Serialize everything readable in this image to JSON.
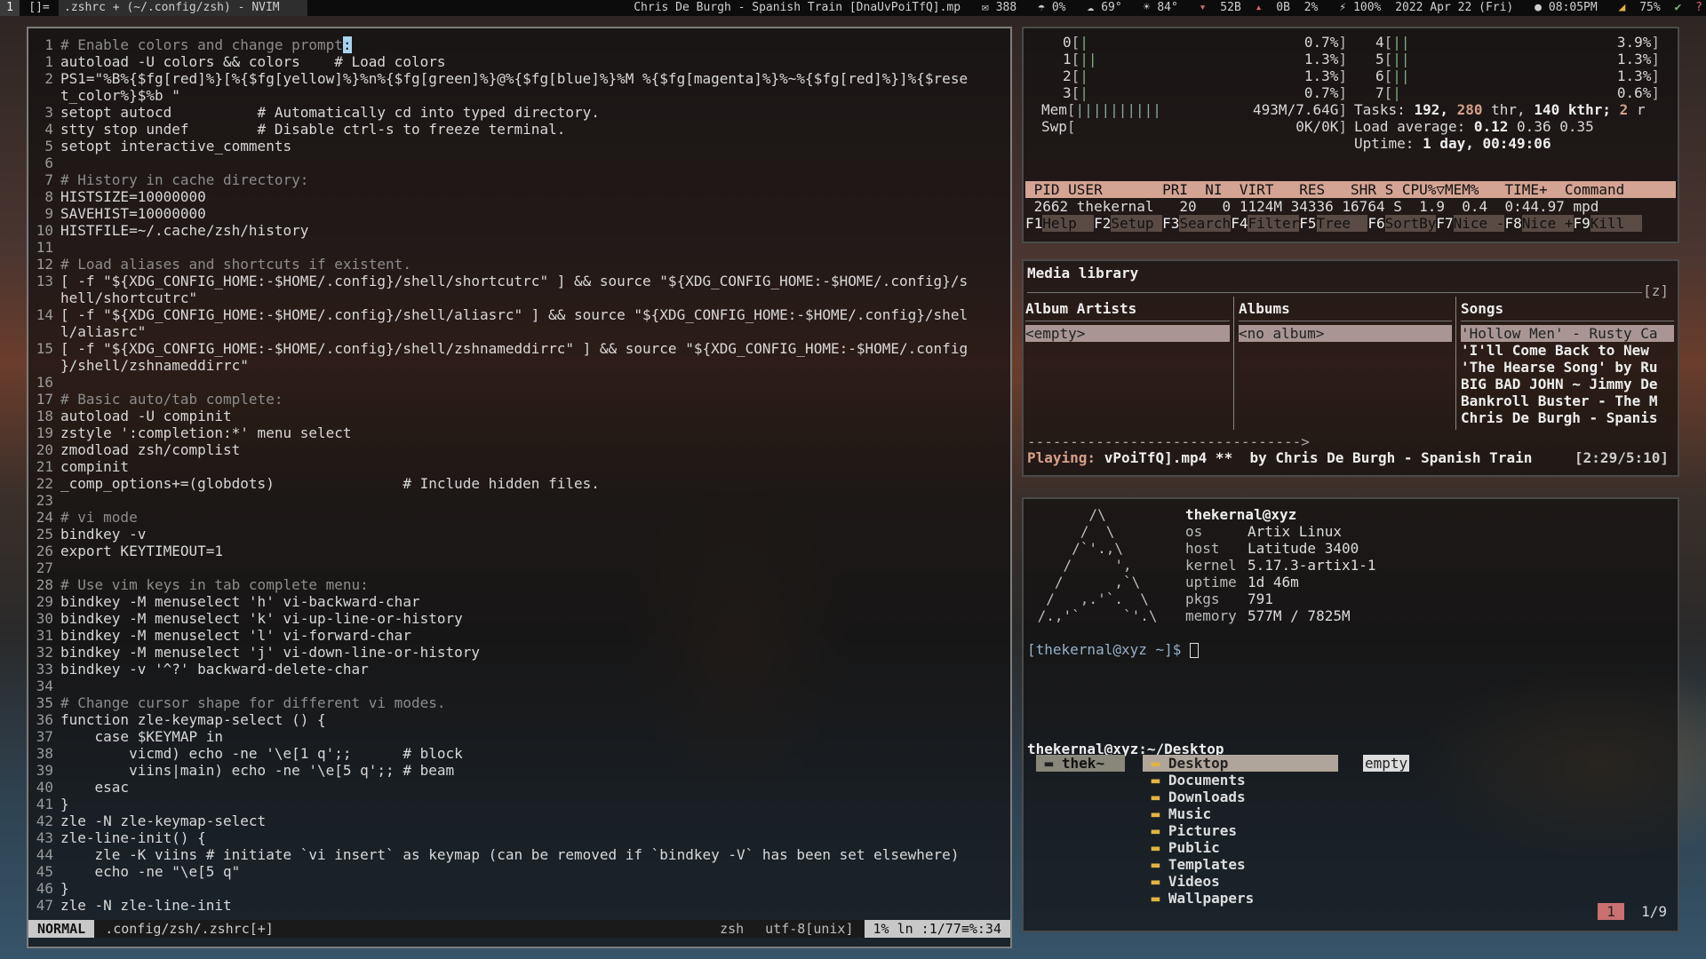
{
  "topbar": {
    "workspace": "1",
    "layout": "[]=",
    "window_title": ".zshrc + (~/.config/zsh) - NVIM",
    "music": "Chris De Burgh - Spanish Train [DnaUvPoiTfQ].mp",
    "mail": "388",
    "rain": "0%",
    "humidity": "69°",
    "temp": "84°",
    "net_down": "52B",
    "net_up": "0B",
    "cpu": "2%",
    "battery": "100%",
    "date": "2022 Apr 22 (Fri)",
    "time": "08:05PM",
    "volume": "75%"
  },
  "editor": {
    "lines": [
      {
        "n": "1",
        "t": "# Enable colors and change prompt",
        "cls": "cm",
        "cursor": ":"
      },
      {
        "n": "1",
        "t": "autoload -U colors && colors    # Load colors"
      },
      {
        "n": "2",
        "t": "PS1=\"%B%{$fg[red]%}[%{$fg[yellow]%}%n%{$fg[green]%}@%{$fg[blue]%}%M %{$fg[magenta]%}%~%{$fg[red]%}]%{$rese"
      },
      {
        "n": "",
        "t": "t_color%}$%b \"",
        "cont": true
      },
      {
        "n": "3",
        "t": "setopt autocd          # Automatically cd into typed directory."
      },
      {
        "n": "4",
        "t": "stty stop undef        # Disable ctrl-s to freeze terminal."
      },
      {
        "n": "5",
        "t": "setopt interactive_comments"
      },
      {
        "n": "6",
        "t": ""
      },
      {
        "n": "7",
        "t": "# History in cache directory:",
        "cls": "cm"
      },
      {
        "n": "8",
        "t": "HISTSIZE=10000000"
      },
      {
        "n": "9",
        "t": "SAVEHIST=10000000"
      },
      {
        "n": "10",
        "t": "HISTFILE=~/.cache/zsh/history"
      },
      {
        "n": "11",
        "t": ""
      },
      {
        "n": "12",
        "t": "# Load aliases and shortcuts if existent.",
        "cls": "cm"
      },
      {
        "n": "13",
        "t": "[ -f \"${XDG_CONFIG_HOME:-$HOME/.config}/shell/shortcutrc\" ] && source \"${XDG_CONFIG_HOME:-$HOME/.config}/s"
      },
      {
        "n": "",
        "t": "hell/shortcutrc\"",
        "cont": true
      },
      {
        "n": "14",
        "t": "[ -f \"${XDG_CONFIG_HOME:-$HOME/.config}/shell/aliasrc\" ] && source \"${XDG_CONFIG_HOME:-$HOME/.config}/shel"
      },
      {
        "n": "",
        "t": "l/aliasrc\"",
        "cont": true
      },
      {
        "n": "15",
        "t": "[ -f \"${XDG_CONFIG_HOME:-$HOME/.config}/shell/zshnameddirrc\" ] && source \"${XDG_CONFIG_HOME:-$HOME/.config"
      },
      {
        "n": "",
        "t": "}/shell/zshnameddirrc\"",
        "cont": true
      },
      {
        "n": "16",
        "t": ""
      },
      {
        "n": "17",
        "t": "# Basic auto/tab complete:",
        "cls": "cm"
      },
      {
        "n": "18",
        "t": "autoload -U compinit"
      },
      {
        "n": "19",
        "t": "zstyle ':completion:*' menu select"
      },
      {
        "n": "20",
        "t": "zmodload zsh/complist"
      },
      {
        "n": "21",
        "t": "compinit"
      },
      {
        "n": "22",
        "t": "_comp_options+=(globdots)               # Include hidden files."
      },
      {
        "n": "23",
        "t": ""
      },
      {
        "n": "24",
        "t": "# vi mode",
        "cls": "cm"
      },
      {
        "n": "25",
        "t": "bindkey -v"
      },
      {
        "n": "26",
        "t": "export KEYTIMEOUT=1"
      },
      {
        "n": "27",
        "t": ""
      },
      {
        "n": "28",
        "t": "# Use vim keys in tab complete menu:",
        "cls": "cm"
      },
      {
        "n": "29",
        "t": "bindkey -M menuselect 'h' vi-backward-char"
      },
      {
        "n": "30",
        "t": "bindkey -M menuselect 'k' vi-up-line-or-history"
      },
      {
        "n": "31",
        "t": "bindkey -M menuselect 'l' vi-forward-char"
      },
      {
        "n": "32",
        "t": "bindkey -M menuselect 'j' vi-down-line-or-history"
      },
      {
        "n": "33",
        "t": "bindkey -v '^?' backward-delete-char"
      },
      {
        "n": "34",
        "t": ""
      },
      {
        "n": "35",
        "t": "# Change cursor shape for different vi modes.",
        "cls": "cm"
      },
      {
        "n": "36",
        "t": "function zle-keymap-select () {"
      },
      {
        "n": "37",
        "t": "    case $KEYMAP in"
      },
      {
        "n": "38",
        "t": "        vicmd) echo -ne '\\e[1 q';;      # block"
      },
      {
        "n": "39",
        "t": "        viins|main) echo -ne '\\e[5 q';; # beam"
      },
      {
        "n": "40",
        "t": "    esac"
      },
      {
        "n": "41",
        "t": "}"
      },
      {
        "n": "42",
        "t": "zle -N zle-keymap-select"
      },
      {
        "n": "43",
        "t": "zle-line-init() {"
      },
      {
        "n": "44",
        "t": "    zle -K viins # initiate `vi insert` as keymap (can be removed if `bindkey -V` has been set elsewhere)"
      },
      {
        "n": "45",
        "t": "    echo -ne \"\\e[5 q\""
      },
      {
        "n": "46",
        "t": "}"
      },
      {
        "n": "47",
        "t": "zle -N zle-line-init"
      }
    ],
    "status": {
      "mode": "NORMAL",
      "file": ".config/zsh/.zshrc[+]",
      "filetype": "zsh",
      "encoding": "utf-8[unix]",
      "position": "1%  ln :1/77≡%:34"
    }
  },
  "htop": {
    "cpus_left": [
      {
        "id": "0",
        "bar": "|",
        "pct": "0.7%"
      },
      {
        "id": "1",
        "bar": "||",
        "pct": "1.3%"
      },
      {
        "id": "2",
        "bar": "|",
        "pct": "1.3%"
      },
      {
        "id": "3",
        "bar": "|",
        "pct": "0.7%"
      }
    ],
    "cpus_right": [
      {
        "id": "4",
        "bar": "||",
        "pct": "3.9%"
      },
      {
        "id": "5",
        "bar": "||",
        "pct": "1.3%"
      },
      {
        "id": "6",
        "bar": "||",
        "pct": "1.3%"
      },
      {
        "id": "7",
        "bar": "|",
        "pct": "0.6%"
      }
    ],
    "mem": {
      "label": "Mem",
      "bar": "||||||||||",
      "value": "493M/7.64G"
    },
    "swp": {
      "label": "Swp",
      "value": "0K/0K"
    },
    "tasks": {
      "label": "Tasks:",
      "tasks": "192,",
      "thr": "280",
      "thr_label": "thr,",
      "kthr": "140 kthr;",
      "running": "2",
      "running_label": "r"
    },
    "load": {
      "label": "Load average:",
      "v1": "0.12",
      "v2": "0.36",
      "v3": "0.35"
    },
    "uptime": {
      "label": "Uptime:",
      "value": "1 day, 00:49:06"
    },
    "header": " PID USER       PRI  NI  VIRT   RES   SHR S CPU%▽MEM%   TIME+  Command",
    "process": " 2662 thekernal   20   0 1124M 34336 16764 S  1.9  0.4  0:44.97 mpd",
    "keys": [
      {
        "k": "F1",
        "d": "Help  "
      },
      {
        "k": "F2",
        "d": "Setup "
      },
      {
        "k": "F3",
        "d": "Search"
      },
      {
        "k": "F4",
        "d": "Filter"
      },
      {
        "k": "F5",
        "d": "Tree  "
      },
      {
        "k": "F6",
        "d": "SortBy"
      },
      {
        "k": "F7",
        "d": "Nice -"
      },
      {
        "k": "F8",
        "d": "Nice +"
      },
      {
        "k": "F9",
        "d": "Kill  "
      }
    ]
  },
  "media": {
    "title": "Media library",
    "z": "[z]",
    "columns": [
      {
        "header": "Album Artists",
        "selected": "<empty>"
      },
      {
        "header": "Albums",
        "selected": "<no album>"
      },
      {
        "header": "Songs",
        "selected": "'Hollow Men' - Rusty Ca"
      }
    ],
    "songs": [
      "'I'll Come Back to New",
      "'The Hearse Song' by Ru",
      "BIG BAD JOHN ~ Jimmy De",
      "Bankroll Buster - The M",
      "Chris De Burgh - Spanis"
    ],
    "progress_line": "-------------------------------->",
    "playing_label": "Playing:",
    "playing": "vPoiTfQ].mp4 **  by Chris De Burgh - Spanish Train",
    "time": "[2:29/5:10]"
  },
  "fetch": {
    "art": "       /\\\n      /  \\\n     /`'.,\\\n    /     ',\n   /      ,`\\\n  /   ,.'`.  \\\n /.,'`     `'.\\",
    "user": "thekernal@xyz",
    "info": [
      {
        "k": "os",
        "v": "Artix Linux"
      },
      {
        "k": "host",
        "v": "Latitude 3400"
      },
      {
        "k": "kernel",
        "v": "5.17.3-artix1-1"
      },
      {
        "k": "uptime",
        "v": "1d 46m"
      },
      {
        "k": "pkgs",
        "v": "791"
      },
      {
        "k": "memory",
        "v": "577M / 7825M"
      }
    ],
    "prompt_user": "[thekernal@xyz ~]$",
    "lf_path": "thekernal@xyz:~/",
    "lf_dir": "Desktop",
    "lf_parent": "thek~",
    "lf_items": [
      "Desktop",
      "Documents",
      "Downloads",
      "Music",
      "Pictures",
      "Public",
      "Templates",
      "Videos",
      "Wallpapers"
    ],
    "lf_preview": "empty",
    "page": "1",
    "count": "1/9"
  }
}
